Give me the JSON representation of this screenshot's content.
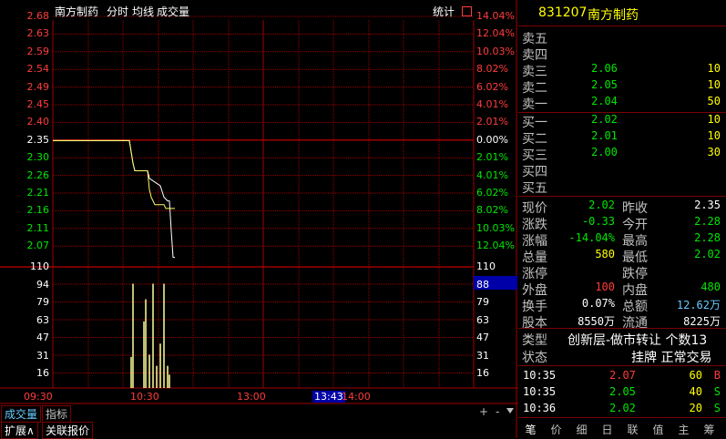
{
  "stock": {
    "code": "831207",
    "name": "南方制药"
  },
  "chart_header": {
    "name": "南方制药",
    "period": "分时",
    "avg_line": "均线",
    "volume": "成交量",
    "stats": "统计"
  },
  "price_axis_left": [
    "2.68",
    "2.63",
    "2.59",
    "2.54",
    "2.49",
    "2.45",
    "2.40",
    "2.35",
    "2.30",
    "2.26",
    "2.21",
    "2.16",
    "2.11",
    "2.07"
  ],
  "pct_axis_right": [
    "14.04%",
    "12.04%",
    "10.03%",
    "8.02%",
    "6.02%",
    "4.01%",
    "2.01%",
    "0.00%",
    "2.01%",
    "4.01%",
    "6.02%",
    "8.02%",
    "10.03%",
    "12.04%"
  ],
  "volume_axis_left": [
    "110",
    "94",
    "79",
    "63",
    "47",
    "31",
    "16"
  ],
  "volume_axis_right": [
    "110",
    "88",
    "79",
    "63",
    "47",
    "31",
    "16"
  ],
  "volume_cursor_value": "88",
  "time_axis": [
    "09:30",
    "10:30",
    "13:00",
    "13:43",
    "14:00"
  ],
  "cursor_time": "13:43",
  "chart_data": {
    "type": "line",
    "prev_close": 2.35,
    "ylim": [
      2.02,
      2.68
    ],
    "series": [
      {
        "values": [
          [
            0,
            2.35
          ],
          [
            84,
            2.35
          ],
          [
            88,
            2.29
          ],
          [
            90,
            2.27
          ],
          [
            104,
            2.27
          ],
          [
            106,
            2.25
          ],
          [
            112,
            2.24
          ],
          [
            118,
            2.23
          ],
          [
            122,
            2.2
          ],
          [
            126,
            2.19
          ],
          [
            128,
            2.19
          ],
          [
            130,
            2.11
          ],
          [
            132,
            2.04
          ],
          [
            134,
            2.04
          ]
        ]
      },
      {
        "values": [
          [
            0,
            2.35
          ],
          [
            84,
            2.35
          ],
          [
            88,
            2.29
          ],
          [
            90,
            2.27
          ],
          [
            104,
            2.27
          ],
          [
            106,
            2.22
          ],
          [
            108,
            2.2
          ],
          [
            112,
            2.18
          ],
          [
            114,
            2.18
          ],
          [
            118,
            2.18
          ],
          [
            122,
            2.18
          ],
          [
            124,
            2.17
          ],
          [
            130,
            2.17
          ],
          [
            134,
            2.17
          ]
        ]
      }
    ],
    "volume": [
      [
        86,
        28
      ],
      [
        88,
        94
      ],
      [
        100,
        60
      ],
      [
        102,
        80
      ],
      [
        106,
        30
      ],
      [
        110,
        94
      ],
      [
        114,
        20
      ],
      [
        118,
        40
      ],
      [
        122,
        94
      ],
      [
        126,
        20
      ],
      [
        128,
        12
      ]
    ]
  },
  "quote": {
    "sells": [
      {
        "label": "卖五",
        "price": "",
        "vol": ""
      },
      {
        "label": "卖四",
        "price": "",
        "vol": ""
      },
      {
        "label": "卖三",
        "price": "2.06",
        "vol": "10"
      },
      {
        "label": "卖二",
        "price": "2.05",
        "vol": "10"
      },
      {
        "label": "卖一",
        "price": "2.04",
        "vol": "50"
      }
    ],
    "buys": [
      {
        "label": "买一",
        "price": "2.02",
        "vol": "10"
      },
      {
        "label": "买二",
        "price": "2.01",
        "vol": "10"
      },
      {
        "label": "买三",
        "price": "2.00",
        "vol": "30"
      },
      {
        "label": "买四",
        "price": "",
        "vol": ""
      },
      {
        "label": "买五",
        "price": "",
        "vol": ""
      }
    ],
    "stats": [
      {
        "l1": "现价",
        "v1": "2.02",
        "c1": "green",
        "l2": "昨收",
        "v2": "2.35",
        "c2": "white"
      },
      {
        "l1": "涨跌",
        "v1": "-0.33",
        "c1": "green",
        "l2": "今开",
        "v2": "2.28",
        "c2": "green"
      },
      {
        "l1": "涨幅",
        "v1": "-14.04%",
        "c1": "green",
        "l2": "最高",
        "v2": "2.28",
        "c2": "green"
      },
      {
        "l1": "总量",
        "v1": "580",
        "c1": "yellow",
        "l2": "最低",
        "v2": "2.02",
        "c2": "green"
      },
      {
        "l1": "涨停",
        "v1": "",
        "c1": "white",
        "l2": "跌停",
        "v2": "",
        "c2": "white"
      },
      {
        "l1": "外盘",
        "v1": "100",
        "c1": "red",
        "l2": "内盘",
        "v2": "480",
        "c2": "green"
      },
      {
        "l1": "换手",
        "v1": "0.07%",
        "c1": "white",
        "l2": "总额",
        "v2": "12.62万",
        "c2": "ltblue"
      },
      {
        "l1": "股本",
        "v1": "8550万",
        "c1": "white",
        "l2": "流通",
        "v2": "8225万",
        "c2": "white"
      }
    ],
    "type_label": "类型",
    "type_value": "创新层-做市转让 个数13",
    "status_label": "状态",
    "status_value": "挂牌 正常交易",
    "trades": [
      {
        "time": "10:35",
        "price": "2.07",
        "vol": "60",
        "side": "B"
      },
      {
        "time": "10:35",
        "price": "2.05",
        "vol": "40",
        "side": "S"
      },
      {
        "time": "10:36",
        "price": "2.02",
        "vol": "20",
        "side": "S"
      }
    ]
  },
  "right_tabs": [
    "笔",
    "价",
    "细",
    "日",
    "联",
    "值",
    "主",
    "筹"
  ],
  "bottom": {
    "tab_volume": "成交量",
    "tab_indicator": "指标",
    "plus": "+",
    "minus": "-",
    "expand": "扩展∧",
    "related": "关联报价"
  },
  "colors": {
    "red": "#ff3c3c",
    "green": "#00e600",
    "axis_red": "#a00000"
  }
}
